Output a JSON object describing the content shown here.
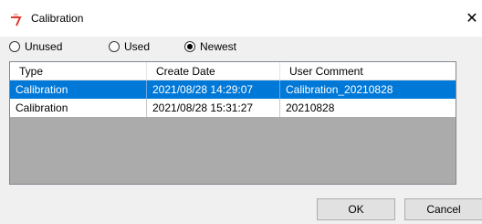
{
  "window": {
    "title": "Calibration",
    "icon": "app-glyph-icon",
    "close_glyph": "✕"
  },
  "filter": {
    "options": [
      {
        "label": "Unused",
        "checked": false
      },
      {
        "label": "Used",
        "checked": false
      },
      {
        "label": "Newest",
        "checked": true
      }
    ]
  },
  "table": {
    "columns": [
      "Type",
      "Create Date",
      "User Comment"
    ],
    "rows": [
      {
        "type": "Calibration",
        "date": "2021/08/28 14:29:07",
        "comment": "Calibration_20210828",
        "selected": true
      },
      {
        "type": "Calibration",
        "date": "2021/08/28 15:31:27",
        "comment": "20210828",
        "selected": false
      }
    ]
  },
  "buttons": {
    "ok": "OK",
    "cancel": "Cancel"
  },
  "colors": {
    "selection": "#0078d7",
    "icon": "#e03a2e"
  }
}
